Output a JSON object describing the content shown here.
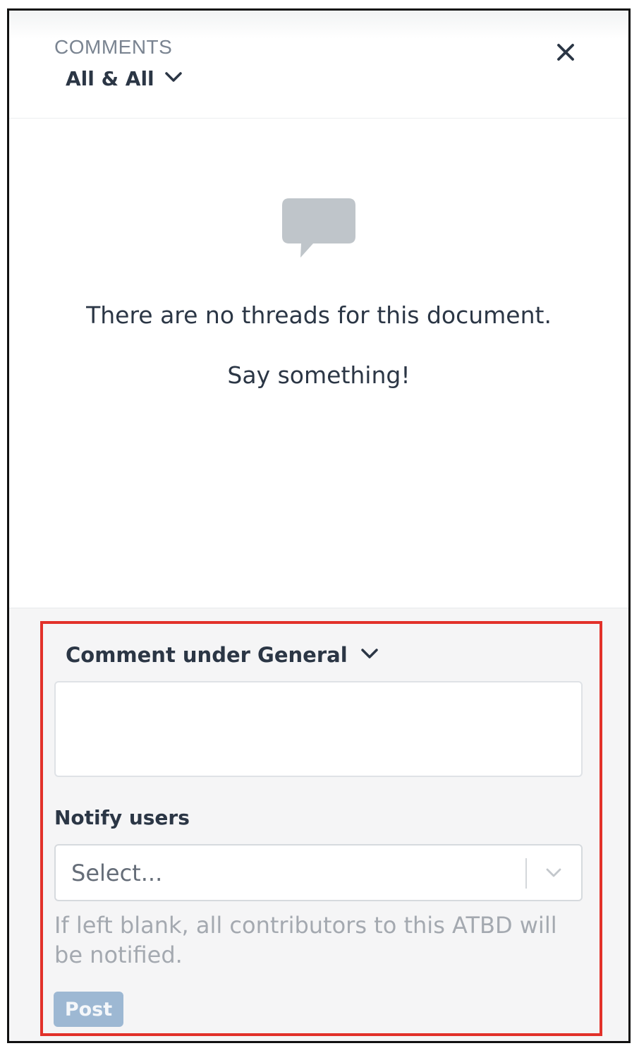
{
  "header": {
    "eyebrow": "COMMENTS",
    "filter_label": "All & All",
    "filter_icon": "chevron-down-icon",
    "close_icon": "close-icon"
  },
  "empty_state": {
    "icon": "speech-bubble-icon",
    "title": "There are no threads for this document.",
    "subtitle": "Say something!"
  },
  "composer": {
    "section_label": "Comment under General",
    "section_icon": "chevron-down-icon",
    "comment_value": "",
    "notify_label": "Notify users",
    "notify_placeholder": "Select...",
    "notify_icon": "chevron-down-icon",
    "help_text": "If left blank, all contributors to this ATBD will be notified.",
    "post_label": "Post",
    "highlight_color": "#e2312a",
    "post_color": "#9db8d3"
  }
}
